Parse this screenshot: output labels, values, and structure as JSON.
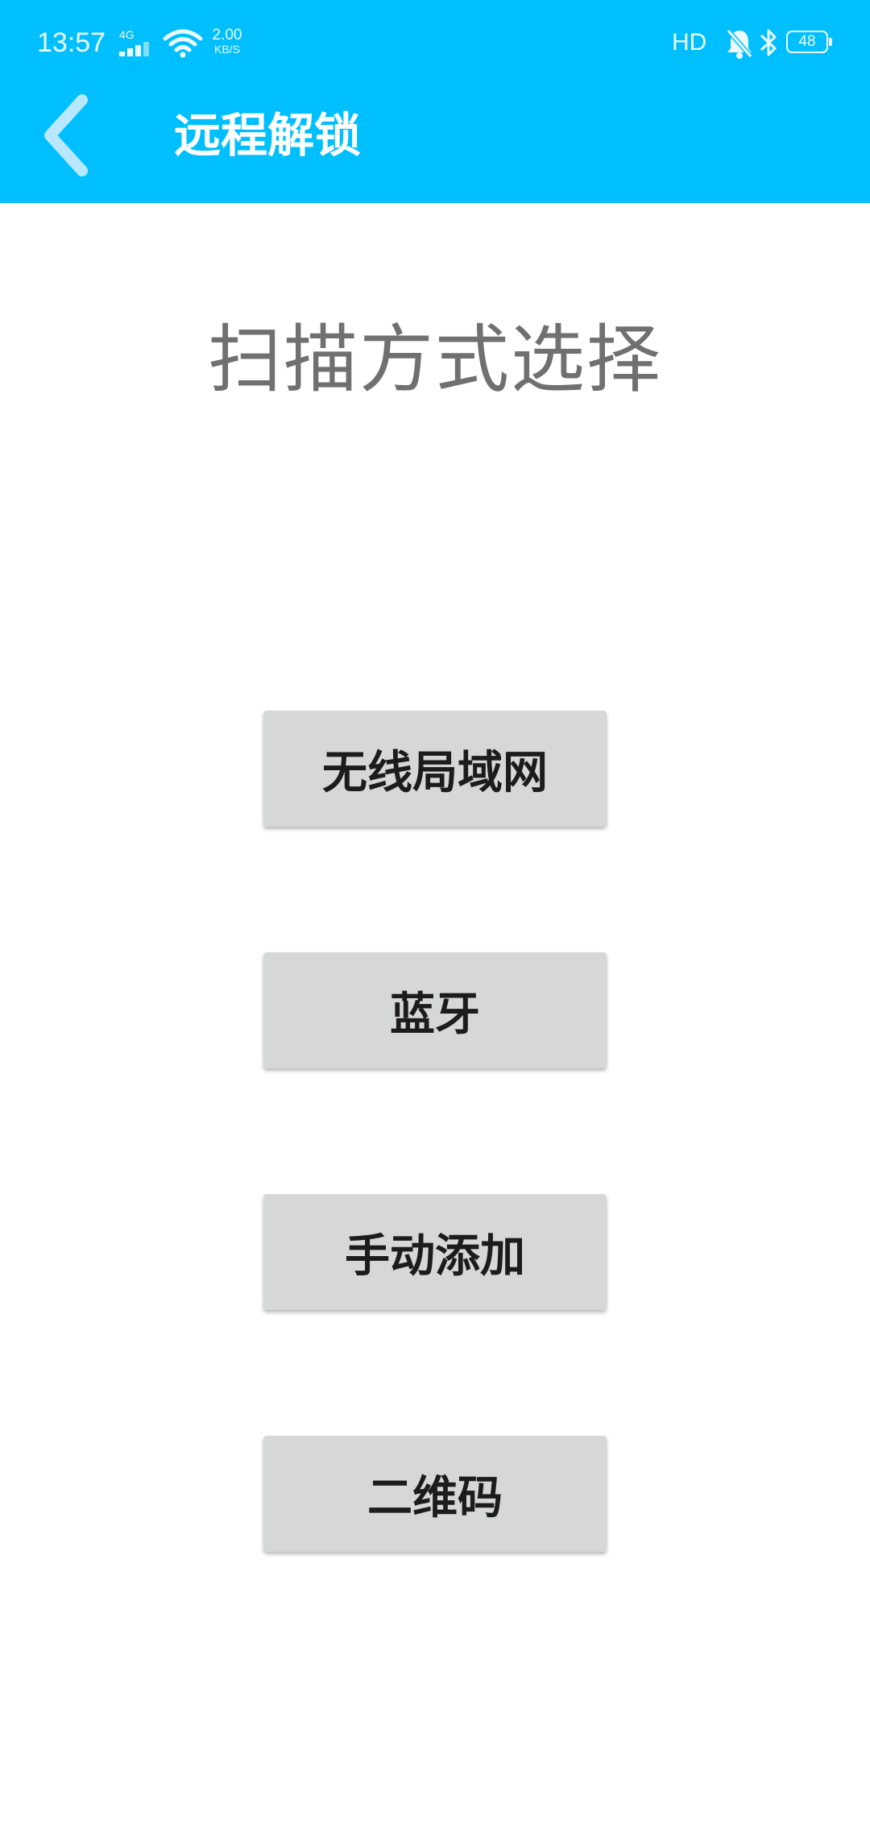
{
  "status_bar": {
    "time": "13:57",
    "network_type": "4G",
    "speed_value": "2.00",
    "speed_unit": "KB/S",
    "hd_label": "HD",
    "battery_level": "48",
    "icons": [
      "signal-icon",
      "wifi-icon",
      "bell-muted-icon",
      "bluetooth-icon",
      "battery-icon"
    ]
  },
  "header": {
    "title": "远程解锁",
    "back_icon": "chevron-left-icon",
    "background_color": "#00bfff"
  },
  "main": {
    "heading": "扫描方式选择",
    "options": [
      {
        "label": "无线局域网"
      },
      {
        "label": "蓝牙"
      },
      {
        "label": "手动添加"
      },
      {
        "label": "二维码"
      }
    ]
  }
}
